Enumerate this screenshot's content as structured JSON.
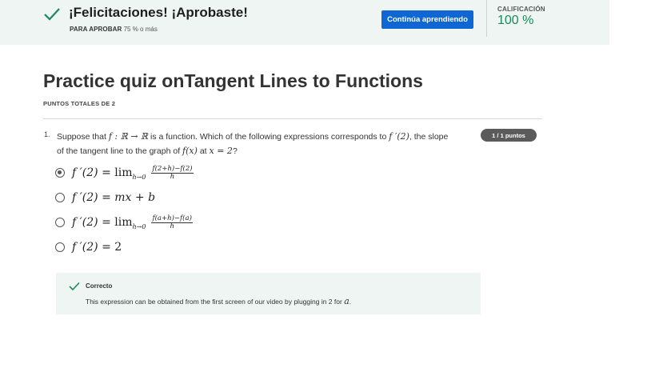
{
  "banner": {
    "title": "¡Felicitaciones! ¡Aprobaste!",
    "pass_label": "PARA APROBAR",
    "pass_value": "75 % o más",
    "continue_label": "Continúa aprendiendo",
    "grade_label": "CALIFICACIÓN",
    "grade_value": "100 %"
  },
  "quiz": {
    "title": "Practice quiz onTangent Lines to Functions",
    "total_points": "PUNTOS TOTALES DE 2"
  },
  "question": {
    "number": "1.",
    "text_1": "Suppose that",
    "math_1": "f : ℝ → ℝ",
    "text_2": "is a function. Which of the following expressions corresponds to",
    "math_2": "f ′(2)",
    "text_3": ", the slope",
    "text_4": "of the tangent line to the graph of",
    "math_3": "f(x)",
    "text_5": "at",
    "math_4": "x = 2",
    "text_6": "?",
    "points_badge": "1 / 1 puntos",
    "options": [
      {
        "lhs": "f ′(2) =",
        "lim": "lim",
        "lim_sub": "h→0",
        "num": "f(2+h)−f(2)",
        "den": "h",
        "selected": true
      },
      {
        "lhs": "f ′(2) =",
        "expr": "mx + b",
        "selected": false
      },
      {
        "lhs": "f ′(2) =",
        "lim": "lim",
        "lim_sub": "h→0",
        "num": "f(a+h)−f(a)",
        "den": "h",
        "selected": false
      },
      {
        "lhs": "f ′(2) =",
        "expr": "2",
        "selected": false
      }
    ]
  },
  "feedback": {
    "title": "Correcto",
    "text": "This expression can be obtained from the first screen of our video by plugging in 2 for",
    "math": "a",
    "suffix": "."
  },
  "colors": {
    "banner_bg": "#eef5f2",
    "accent_green": "#1b8a5a",
    "button_blue": "#0f67d3",
    "badge_gray": "#5b5b5b"
  },
  "icons": {
    "check": "checkmark-icon",
    "radio": "radio-button"
  }
}
